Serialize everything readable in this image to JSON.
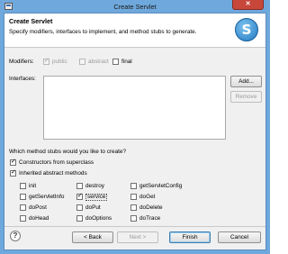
{
  "window": {
    "title": "Create Servlet",
    "close_glyph": "✕"
  },
  "banner": {
    "title": "Create Servlet",
    "description": "Specify modifiers, interfaces to implement, and method stubs to generate."
  },
  "modifiers": {
    "label": "Modifiers:",
    "public": {
      "label": "public",
      "checked": true,
      "enabled": false
    },
    "abstract": {
      "label": "abstract",
      "checked": false,
      "enabled": false
    },
    "final": {
      "label": "final",
      "checked": false,
      "enabled": true
    }
  },
  "interfaces": {
    "label": "Interfaces:",
    "add_label": "Add...",
    "remove_label": "Remove"
  },
  "stubs": {
    "question": "Which method stubs would you like to create?",
    "constructors": {
      "label": "Constructors from superclass",
      "checked": true
    },
    "inherited": {
      "label": "Inherited abstract methods",
      "checked": true
    },
    "methods": [
      {
        "label": "init",
        "checked": false
      },
      {
        "label": "destroy",
        "checked": false
      },
      {
        "label": "getServletConfig",
        "checked": false
      },
      {
        "label": "getServletInfo",
        "checked": false
      },
      {
        "label": "service",
        "checked": true
      },
      {
        "label": "doGet",
        "checked": false
      },
      {
        "label": "doPost",
        "checked": false
      },
      {
        "label": "doPut",
        "checked": false
      },
      {
        "label": "doDelete",
        "checked": false
      },
      {
        "label": "doHead",
        "checked": false
      },
      {
        "label": "doOptions",
        "checked": false
      },
      {
        "label": "doTrace",
        "checked": false
      }
    ]
  },
  "footer": {
    "help_glyph": "?",
    "back_label": "< Back",
    "next_label": "Next >",
    "finish_label": "Finish",
    "cancel_label": "Cancel"
  }
}
